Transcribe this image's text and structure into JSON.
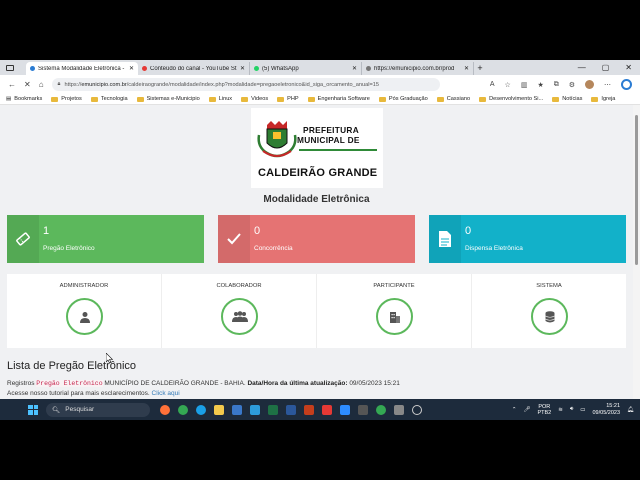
{
  "browser": {
    "tabs": [
      {
        "title": "Sistema Modalidade Eletrônica -",
        "active": true,
        "favicon_color": "#2b7cd3"
      },
      {
        "title": "Conteúdo do canal - YouTube St",
        "active": false,
        "favicon_color": "#e53935"
      },
      {
        "title": "(5) WhatsApp",
        "active": false,
        "favicon_color": "#25d366"
      },
      {
        "title": "https://emunicipio.com.br/prod",
        "active": false,
        "favicon_color": "#777777"
      }
    ],
    "url_prefix": "https://",
    "url_host": "emunicipio.com.br",
    "url_path": "/caldeiraogrande/modalidade/index.php?modalidade=pregaoeletronico&id_siga_orcamento_anual=15",
    "bookmarks": [
      "Bookmarks",
      "Projetos",
      "Tecnologia",
      "Sistemas e-Municipio",
      "Linux",
      "Videos",
      "PHP",
      "Engenharia Software",
      "Pós Graduação",
      "Cassiano",
      "Desenvolvimento Si...",
      "Notícias",
      "Igreja"
    ]
  },
  "logo": {
    "line1": "PREFEITURA",
    "line2": "MUNICIPAL DE",
    "name": "CALDEIRÃO GRANDE"
  },
  "page": {
    "subtitle": "Modalidade Eletrônica",
    "cards": [
      {
        "count": "1",
        "label": "Pregão Eletrônico",
        "icon": "ticket-icon",
        "color": "#5cb85c"
      },
      {
        "count": "0",
        "label": "Concorrência",
        "icon": "check-icon",
        "color": "#e57373"
      },
      {
        "count": "0",
        "label": "Dispensa Eletrônica",
        "icon": "document-icon",
        "color": "#12b1c9"
      }
    ],
    "roles": [
      {
        "title": "ADMINISTRADOR",
        "icon": "admin-user-icon"
      },
      {
        "title": "COLABORADOR",
        "icon": "team-icon"
      },
      {
        "title": "PARTICIPANTE",
        "icon": "building-icon"
      },
      {
        "title": "SISTEMA",
        "icon": "database-icon"
      }
    ],
    "list_title": "Lista de Pregão Eletrônico",
    "registry_prefix": "Registros",
    "registry_tag": "Pregão Eletrônico",
    "registry_text": "MUNICÍPIO DE CALDEIRÃO GRANDE - BAHIA.",
    "update_label": "Data/Hora da última atualização:",
    "update_value": "09/05/2023 15:21",
    "tutorial_text": "Acesse nosso tutorial para mais esclarecimentos.",
    "tutorial_link": "Click aqui"
  },
  "taskbar": {
    "search_placeholder": "Pesquisar",
    "lang_line1": "POR",
    "lang_line2": "PTB2",
    "time": "15:21",
    "date": "09/05/2023"
  }
}
